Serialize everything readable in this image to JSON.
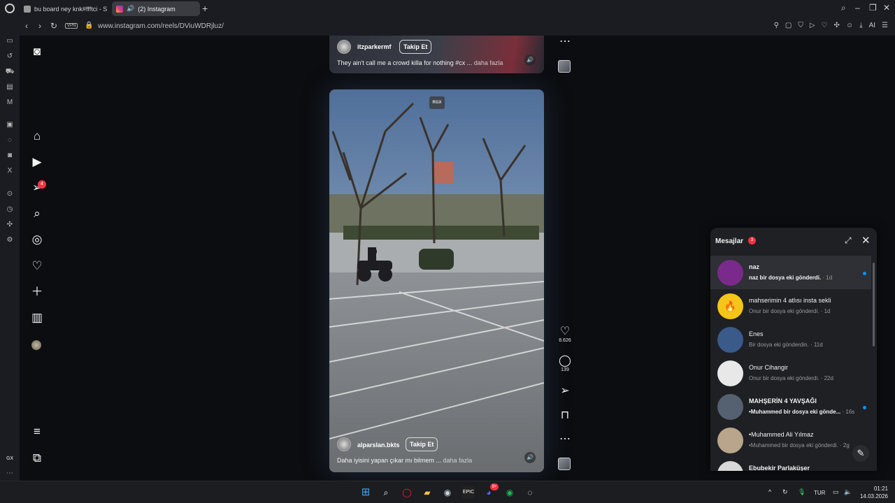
{
  "browser": {
    "tabs": [
      {
        "label": "bu board ney knk#ffftci - S",
        "active": false
      },
      {
        "label": "(2) Instagram",
        "active": true
      }
    ],
    "url": "www.instagram.com/reels/DViuWDRjluz/",
    "vpn_label": "VPN",
    "ai_label": "AI",
    "sidebar_gx_label": "GX"
  },
  "ig_nav": {
    "notifications_badge": "4"
  },
  "reels": [
    {
      "username": "itzparkermf",
      "follow_label": "Takip Et",
      "caption": "They ain't call me a crowd killa for nothing #cx ...",
      "more_label": "daha fazla"
    },
    {
      "username": "alparslan.bkts",
      "follow_label": "Takip Et",
      "caption": "Daha iyisini yapan çıkar mı bilmem ...",
      "more_label": "daha fazla",
      "watermark": "RGX",
      "likes": "8.626",
      "comments": "139"
    }
  ],
  "messages": {
    "title": "Mesajlar",
    "badge": "3",
    "conversations": [
      {
        "name": "naz",
        "preview": "naz bir dosya eki gönderdi.",
        "time": " · 1d",
        "unread": true,
        "bold": true,
        "avatar_color": "#7a2a8a"
      },
      {
        "name": "mahserimin 4 atlısı insta sekli",
        "preview": "Onur bir dosya eki gönderdi.",
        "time": " · 1d",
        "unread": false,
        "bold": false,
        "avatar_color": "#f5c518"
      },
      {
        "name": "Enes",
        "preview": "Bir dosya eki gönderdin.",
        "time": " · 11d",
        "unread": false,
        "bold": false,
        "avatar_color": "#3a5a8a"
      },
      {
        "name": "Onur Cihangir",
        "preview": "Onur bir dosya eki gönderdi.",
        "time": " · 22d",
        "unread": false,
        "bold": false,
        "avatar_color": "#e8e8e8"
      },
      {
        "name": "MAHŞERİN 4 YAVŞAĞI",
        "preview": "•Muhammed bir dosya eki gönde...",
        "time": " · 16s",
        "unread": true,
        "bold": true,
        "avatar_color": "#556070"
      },
      {
        "name": "•Muhammed Ali Yılmaz",
        "preview": "•Muhammed bir dosya eki gönderdi.",
        "time": " · 2g",
        "unread": false,
        "bold": false,
        "avatar_color": "#b8a58a"
      },
      {
        "name": "Ebubekir Parlaküşer",
        "preview": "",
        "time": "",
        "unread": false,
        "bold": true,
        "avatar_color": "#d8d8d8"
      }
    ]
  },
  "taskbar": {
    "language": "TUR",
    "time": "01:21",
    "date": "14.03.2026",
    "discord_badge": "9+"
  }
}
